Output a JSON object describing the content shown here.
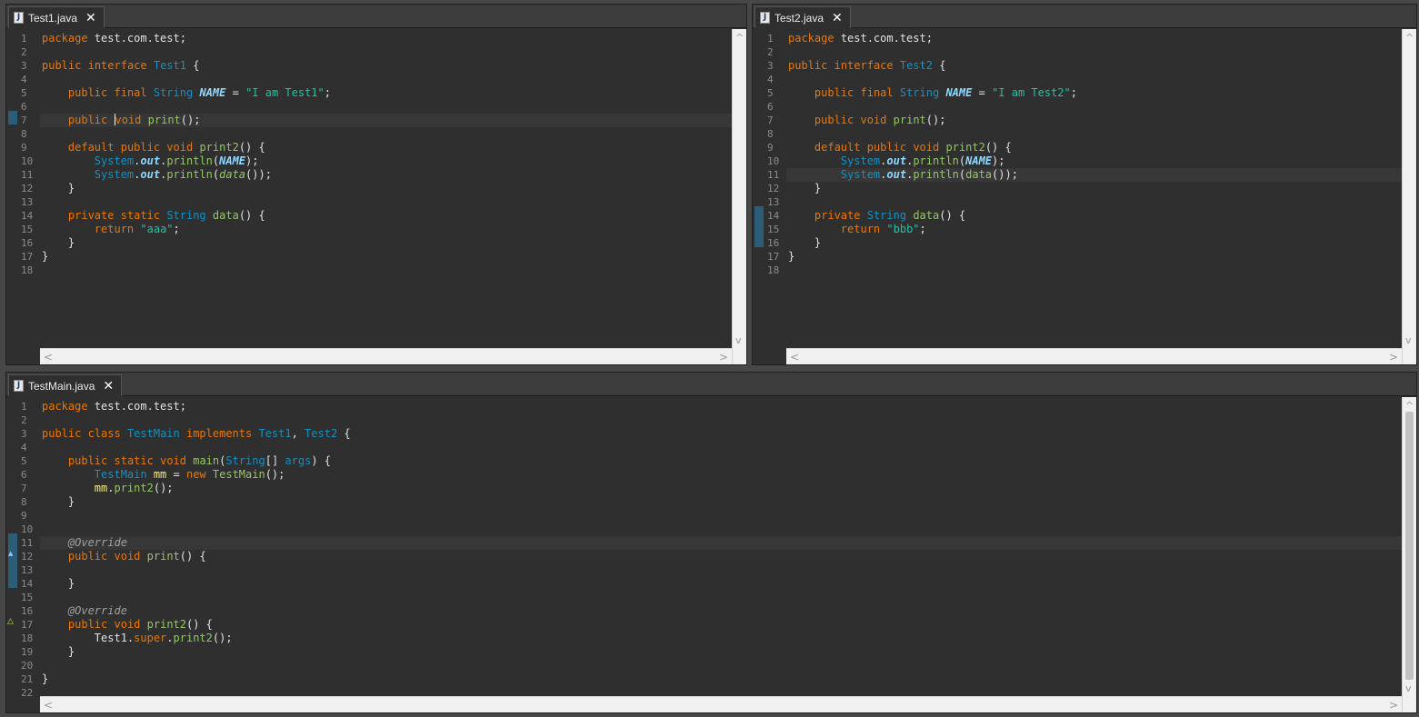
{
  "test1": {
    "tab": {
      "title": "Test1.java",
      "icon": "J"
    },
    "lines": [
      {
        "n": "1",
        "html": "<span class=\"kw\">package</span> <span class=\"pl\">test.com.test;</span>"
      },
      {
        "n": "2",
        "html": ""
      },
      {
        "n": "3",
        "html": "<span class=\"kw\">public</span> <span class=\"kw\">interface</span> <span class=\"ty\">Test1</span> <span class=\"pl\">{</span>"
      },
      {
        "n": "4",
        "html": ""
      },
      {
        "n": "5",
        "html": "    <span class=\"kw\">public</span> <span class=\"kw\">final</span> <span class=\"ty\">String</span> <span class=\"cst\">NAME</span> <span class=\"pl\">=</span> <span class=\"st\">\"I am Test1\"</span><span class=\"pl\">;</span>"
      },
      {
        "n": "6",
        "html": ""
      },
      {
        "n": "7",
        "html": "    <span class=\"kw\">public</span> <span class=\"caret\"></span><span class=\"kw\">void</span> <span class=\"fn\">print</span><span class=\"pl\">();</span>",
        "current": true
      },
      {
        "n": "8",
        "html": ""
      },
      {
        "n": "9",
        "html": "    <span class=\"kw\">default</span> <span class=\"kw\">public</span> <span class=\"kw\">void</span> <span class=\"fn\">print2</span><span class=\"pl\">() {</span>",
        "fold": true
      },
      {
        "n": "10",
        "html": "        <span class=\"ty\">System</span><span class=\"pl\">.</span><span class=\"bi\">out</span><span class=\"pl\">.</span><span class=\"fn\">println</span><span class=\"pl\">(</span><span class=\"cst\">NAME</span><span class=\"pl\">);</span>"
      },
      {
        "n": "11",
        "html": "        <span class=\"ty\">System</span><span class=\"pl\">.</span><span class=\"bi\">out</span><span class=\"pl\">.</span><span class=\"fn\">println</span><span class=\"pl\">(</span><span class=\"fn it\">data</span><span class=\"pl\">());</span>"
      },
      {
        "n": "12",
        "html": "    <span class=\"pl\">}</span>"
      },
      {
        "n": "13",
        "html": ""
      },
      {
        "n": "14",
        "html": "    <span class=\"kw\">private</span> <span class=\"kw\">static</span> <span class=\"ty\">String</span> <span class=\"fn\">data</span><span class=\"pl\">() {</span>",
        "fold": true
      },
      {
        "n": "15",
        "html": "        <span class=\"kw\">return</span> <span class=\"st\">\"aaa\"</span><span class=\"pl\">;</span>"
      },
      {
        "n": "16",
        "html": "    <span class=\"pl\">}</span>"
      },
      {
        "n": "17",
        "html": "<span class=\"pl\">}</span>"
      },
      {
        "n": "18",
        "html": ""
      }
    ]
  },
  "test2": {
    "tab": {
      "title": "Test2.java",
      "icon": "J"
    },
    "lines": [
      {
        "n": "1",
        "html": "<span class=\"kw\">package</span> <span class=\"pl\">test.com.test;</span>"
      },
      {
        "n": "2",
        "html": ""
      },
      {
        "n": "3",
        "html": "<span class=\"kw\">public</span> <span class=\"kw\">interface</span> <span class=\"ty\">Test2</span> <span class=\"pl\">{</span>"
      },
      {
        "n": "4",
        "html": ""
      },
      {
        "n": "5",
        "html": "    <span class=\"kw\">public</span> <span class=\"kw\">final</span> <span class=\"ty\">String</span> <span class=\"cst\">NAME</span> <span class=\"pl\">=</span> <span class=\"st\">\"I am Test2\"</span><span class=\"pl\">;</span>"
      },
      {
        "n": "6",
        "html": ""
      },
      {
        "n": "7",
        "html": "    <span class=\"kw\">public</span> <span class=\"kw\">void</span> <span class=\"fn\">print</span><span class=\"pl\">();</span>"
      },
      {
        "n": "8",
        "html": ""
      },
      {
        "n": "9",
        "html": "    <span class=\"kw\">default</span> <span class=\"kw\">public</span> <span class=\"kw\">void</span> <span class=\"fn\">print2</span><span class=\"pl\">() {</span>",
        "fold": true
      },
      {
        "n": "10",
        "html": "        <span class=\"ty\">System</span><span class=\"pl\">.</span><span class=\"bi\">out</span><span class=\"pl\">.</span><span class=\"fn\">println</span><span class=\"pl\">(</span><span class=\"cst\">NAME</span><span class=\"pl\">);</span>"
      },
      {
        "n": "11",
        "html": "        <span class=\"ty\">System</span><span class=\"pl\">.</span><span class=\"bi\">out</span><span class=\"pl\">.</span><span class=\"fn\">println</span><span class=\"pl\">(</span><span class=\"fn\">data</span><span class=\"pl\">());</span>",
        "current": true
      },
      {
        "n": "12",
        "html": "    <span class=\"pl\">}</span>"
      },
      {
        "n": "13",
        "html": ""
      },
      {
        "n": "14",
        "html": "    <span class=\"kw\">private</span> <span class=\"ty\">String</span> <span class=\"fn\">data</span><span class=\"pl\">() {</span>",
        "fold": true
      },
      {
        "n": "15",
        "html": "        <span class=\"kw\">return</span> <span class=\"st\">\"bbb\"</span><span class=\"pl\">;</span>"
      },
      {
        "n": "16",
        "html": "    <span class=\"pl\">}</span>"
      },
      {
        "n": "17",
        "html": "<span class=\"pl\">}</span>"
      },
      {
        "n": "18",
        "html": ""
      }
    ]
  },
  "testmain": {
    "tab": {
      "title": "TestMain.java",
      "icon": "J"
    },
    "lines": [
      {
        "n": "1",
        "html": "<span class=\"kw\">package</span> <span class=\"pl\">test.com.test;</span>"
      },
      {
        "n": "2",
        "html": ""
      },
      {
        "n": "3",
        "html": "<span class=\"kw\">public</span> <span class=\"kw\">class</span> <span class=\"ty\">TestMain</span> <span class=\"kw\">implements</span> <span class=\"ty\">Test1</span><span class=\"pl\">,</span> <span class=\"ty\">Test2</span> <span class=\"pl\">{</span>"
      },
      {
        "n": "4",
        "html": ""
      },
      {
        "n": "5",
        "html": "    <span class=\"kw\">public</span> <span class=\"kw\">static</span> <span class=\"kw\">void</span> <span class=\"fn\">main</span><span class=\"pl\">(</span><span class=\"ty\">String</span><span class=\"pl\">[]</span> <span class=\"ty\">args</span><span class=\"pl\">) {</span>",
        "fold": true
      },
      {
        "n": "6",
        "html": "        <span class=\"ty\">TestMain</span> <span class=\"var\">mm</span> <span class=\"pl\">=</span> <span class=\"kw\">new</span> <span class=\"fn\">TestMain</span><span class=\"pl\">();</span>"
      },
      {
        "n": "7",
        "html": "        <span class=\"var\">mm</span><span class=\"pl\">.</span><span class=\"fn\">print2</span><span class=\"pl\">();</span>"
      },
      {
        "n": "8",
        "html": "    <span class=\"pl\">}</span>"
      },
      {
        "n": "9",
        "html": ""
      },
      {
        "n": "10",
        "html": ""
      },
      {
        "n": "11",
        "html": "    <span class=\"ann\">@Override</span>",
        "fold": true,
        "current": true
      },
      {
        "n": "12",
        "html": "    <span class=\"kw\">public</span> <span class=\"kw\">void</span> <span class=\"fn\">print</span><span class=\"pl\">() {</span>"
      },
      {
        "n": "13",
        "html": ""
      },
      {
        "n": "14",
        "html": "    <span class=\"pl\">}</span>"
      },
      {
        "n": "15",
        "html": ""
      },
      {
        "n": "16",
        "html": "    <span class=\"ann\">@Override</span>",
        "fold": true
      },
      {
        "n": "17",
        "html": "    <span class=\"kw\">public</span> <span class=\"kw\">void</span> <span class=\"fn\">print2</span><span class=\"pl\">() {</span>"
      },
      {
        "n": "18",
        "html": "        <span class=\"pl\">Test1.</span><span class=\"kw\">super</span><span class=\"pl\">.</span><span class=\"fn\">print2</span><span class=\"pl\">();</span>"
      },
      {
        "n": "19",
        "html": "    <span class=\"pl\">}</span>"
      },
      {
        "n": "20",
        "html": ""
      },
      {
        "n": "21",
        "html": "<span class=\"pl\">}</span>"
      },
      {
        "n": "22",
        "html": ""
      }
    ]
  },
  "icons": {
    "close": "✕",
    "scroll_left": "<",
    "scroll_right": ">",
    "scroll_up": "^",
    "scroll_down": "v",
    "override_marker": "▲",
    "implements_marker": "△"
  },
  "colors": {
    "background": "#2f2f2f",
    "keyword": "#ec7600",
    "type": "#1290c3",
    "method": "#93c763",
    "string": "#17c6a3"
  }
}
